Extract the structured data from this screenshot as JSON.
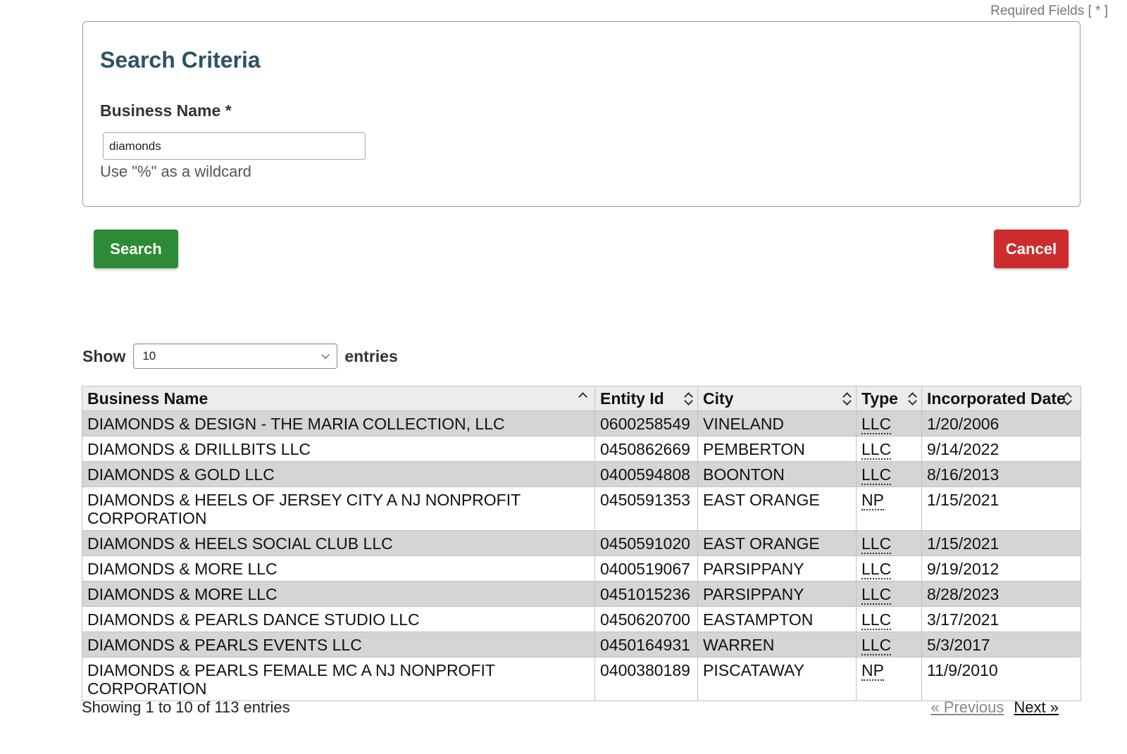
{
  "required_note": "Required Fields [ * ]",
  "search_criteria": {
    "title": "Search Criteria",
    "business_name_label": "Business Name *",
    "business_name_value": "diamonds",
    "hint": "Use \"%\" as a wildcard"
  },
  "buttons": {
    "search": "Search",
    "cancel": "Cancel",
    "search_color": "#2e8b35",
    "cancel_color": "#cc2c2c"
  },
  "length_menu": {
    "show_label": "Show",
    "selected": "10",
    "entries_label": "entries"
  },
  "table": {
    "headers": [
      "Business Name",
      "Entity Id",
      "City",
      "Type",
      "Incorporated Date"
    ],
    "rows": [
      [
        "DIAMONDS & DESIGN - THE MARIA COLLECTION, LLC",
        "0600258549",
        "VINELAND",
        "LLC",
        "1/20/2006"
      ],
      [
        "DIAMONDS & DRILLBITS LLC",
        "0450862669",
        "PEMBERTON",
        "LLC",
        "9/14/2022"
      ],
      [
        "DIAMONDS & GOLD LLC",
        "0400594808",
        "BOONTON",
        "LLC",
        "8/16/2013"
      ],
      [
        "DIAMONDS & HEELS OF JERSEY CITY A NJ NONPROFIT CORPORATION",
        "0450591353",
        "EAST ORANGE",
        "NP",
        "1/15/2021"
      ],
      [
        "DIAMONDS & HEELS SOCIAL CLUB LLC",
        "0450591020",
        "EAST ORANGE",
        "LLC",
        "1/15/2021"
      ],
      [
        "DIAMONDS & MORE LLC",
        "0400519067",
        "PARSIPPANY",
        "LLC",
        "9/19/2012"
      ],
      [
        "DIAMONDS & MORE LLC",
        "0451015236",
        "PARSIPPANY",
        "LLC",
        "8/28/2023"
      ],
      [
        "DIAMONDS & PEARLS DANCE STUDIO LLC",
        "0450620700",
        "EASTAMPTON",
        "LLC",
        "3/17/2021"
      ],
      [
        "DIAMONDS & PEARLS EVENTS LLC",
        "0450164931",
        "WARREN",
        "LLC",
        "5/3/2017"
      ],
      [
        "DIAMONDS & PEARLS FEMALE MC A NJ NONPROFIT CORPORATION",
        "0400380189",
        "PISCATAWAY",
        "NP",
        "11/9/2010"
      ]
    ]
  },
  "footer": {
    "info": "Showing 1 to 10 of 113 entries",
    "previous": "« Previous",
    "next": "Next »"
  }
}
